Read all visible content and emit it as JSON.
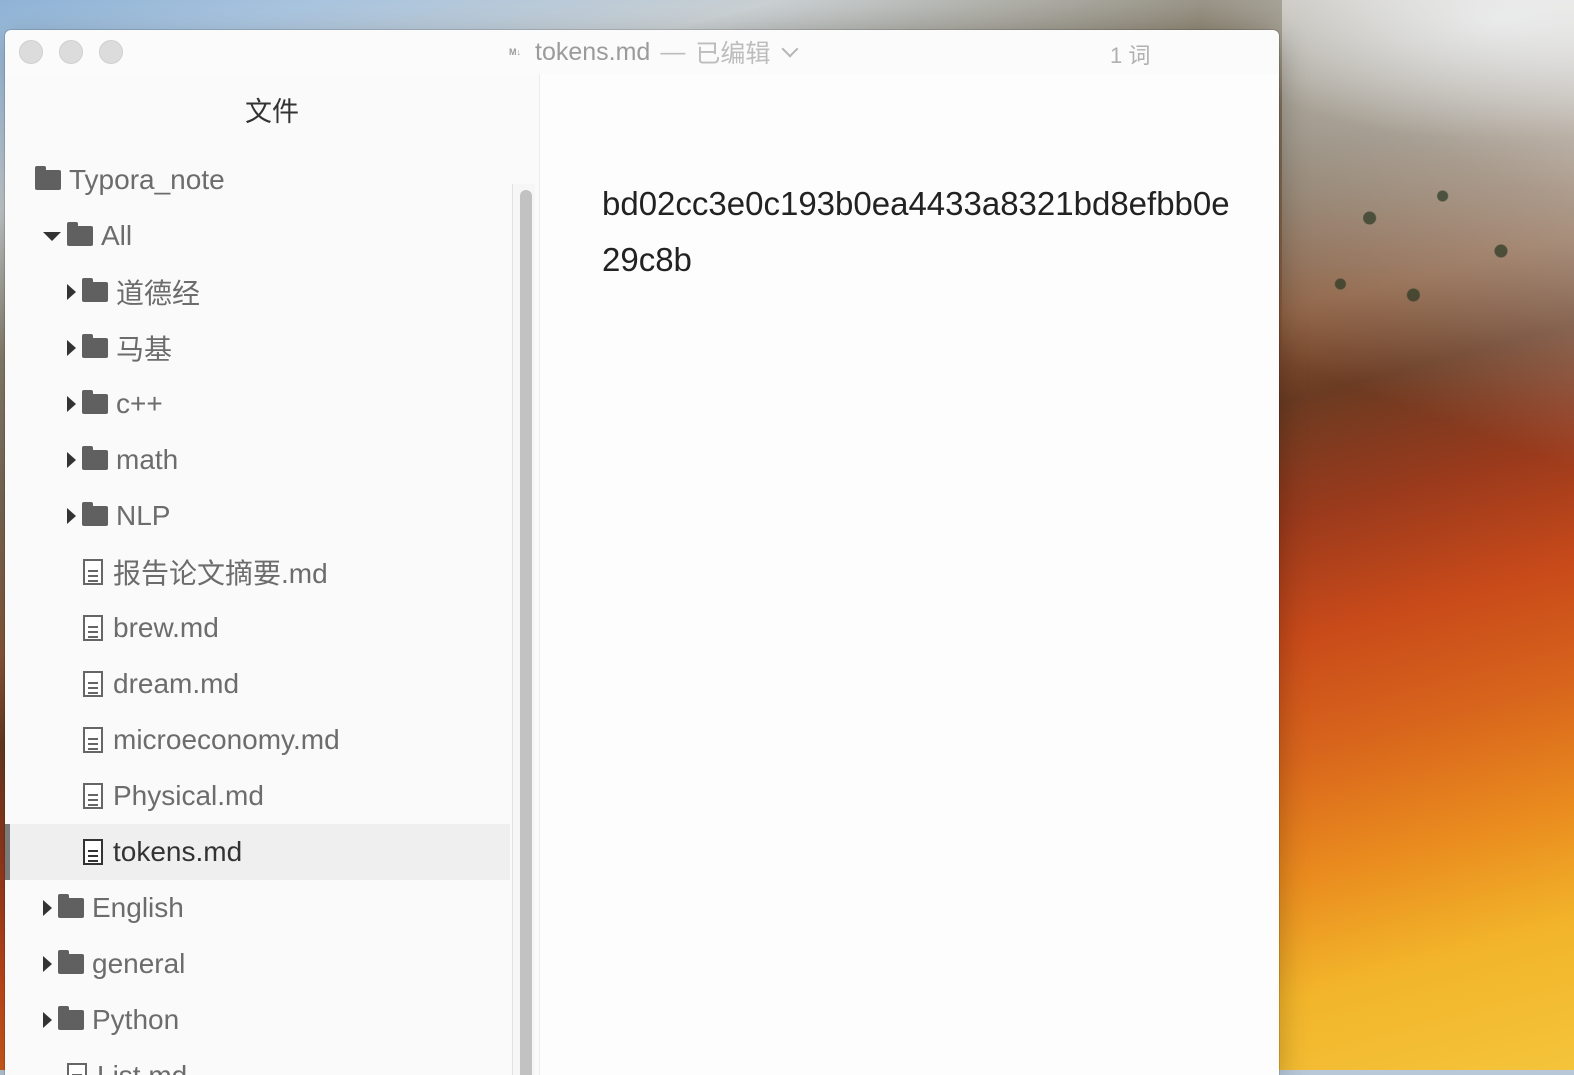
{
  "window": {
    "doc_icon_label": "M↓",
    "doc_name": "tokens.md",
    "doc_separator": "—",
    "doc_state": "已编辑",
    "word_count": "1 词"
  },
  "sidebar": {
    "title": "文件",
    "items": [
      {
        "label": "Typora_note",
        "kind": "folder",
        "level": 0,
        "expander": "none"
      },
      {
        "label": "All",
        "kind": "folder",
        "level": 1,
        "expander": "expanded"
      },
      {
        "label": "道德经",
        "kind": "folder",
        "level": 2,
        "expander": "collapsed"
      },
      {
        "label": "马基",
        "kind": "folder",
        "level": 2,
        "expander": "collapsed"
      },
      {
        "label": "c++",
        "kind": "folder",
        "level": 2,
        "expander": "collapsed"
      },
      {
        "label": "math",
        "kind": "folder",
        "level": 2,
        "expander": "collapsed"
      },
      {
        "label": "NLP",
        "kind": "folder",
        "level": 2,
        "expander": "collapsed"
      },
      {
        "label": "报告论文摘要.md",
        "kind": "file",
        "level": 2
      },
      {
        "label": "brew.md",
        "kind": "file",
        "level": 2
      },
      {
        "label": "dream.md",
        "kind": "file",
        "level": 2
      },
      {
        "label": "microeconomy.md",
        "kind": "file",
        "level": 2
      },
      {
        "label": "Physical.md",
        "kind": "file",
        "level": 2
      },
      {
        "label": "tokens.md",
        "kind": "file",
        "level": 2,
        "selected": true
      },
      {
        "label": "English",
        "kind": "folder",
        "level": 1,
        "expander": "collapsed"
      },
      {
        "label": "general",
        "kind": "folder",
        "level": 1,
        "expander": "collapsed"
      },
      {
        "label": "Python",
        "kind": "folder",
        "level": 1,
        "expander": "collapsed"
      },
      {
        "label": "List.md",
        "kind": "file",
        "level": 1
      }
    ]
  },
  "editor": {
    "content": "bd02cc3e0c193b0ea4433a8321bd8efbb0e29c8b"
  },
  "colors": {
    "window_bg": "#fbfbfb",
    "sidebar_bg": "#fafafa",
    "selected_row": "#efefef",
    "text_primary": "#222222",
    "text_secondary": "#6c6c6c"
  }
}
